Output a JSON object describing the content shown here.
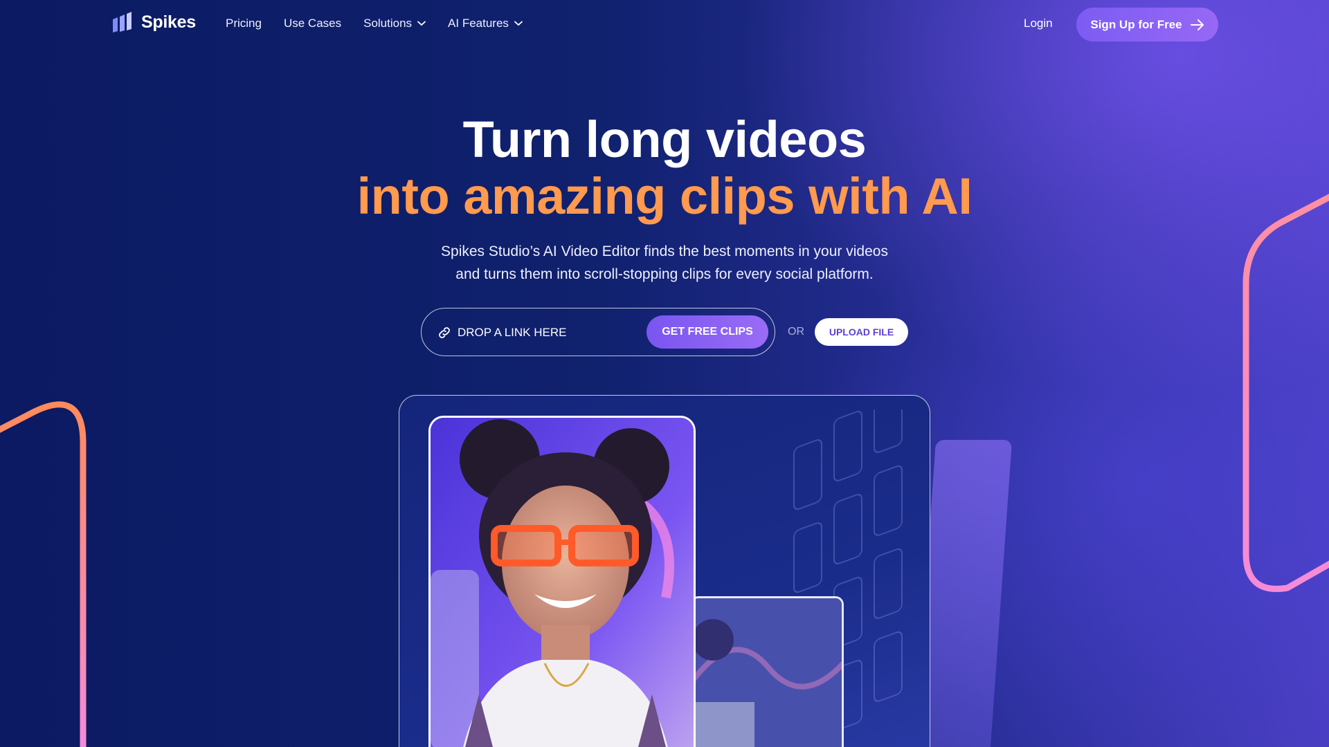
{
  "brand": {
    "name": "Spikes"
  },
  "nav": {
    "links": [
      {
        "label": "Pricing",
        "has_dropdown": false
      },
      {
        "label": "Use Cases",
        "has_dropdown": false
      },
      {
        "label": "Solutions",
        "has_dropdown": true
      },
      {
        "label": "AI Features",
        "has_dropdown": true
      }
    ],
    "login": "Login",
    "signup": "Sign Up for Free"
  },
  "hero": {
    "title_line1": "Turn long videos",
    "title_line2": "into amazing clips with AI",
    "subtitle_line1": "Spikes Studio’s AI Video Editor finds the best moments in your videos",
    "subtitle_line2": "and turns them into scroll-stopping clips for every social platform.",
    "link_placeholder": "DROP A LINK HERE",
    "cta_label": "GET FREE CLIPS",
    "or_label": "OR",
    "upload_label": "UPLOAD FILE"
  },
  "colors": {
    "background": "#0c1a66",
    "accent_purple": "#7c5cf3",
    "title_orange": "#ff9a4e",
    "deco_gradient_start": "#ff8a5b",
    "deco_gradient_end": "#f58bd8"
  },
  "icons": {
    "logo": "bars-logo-icon",
    "arrow": "arrow-right-icon",
    "link": "link-icon",
    "chevron": "chevron-down-icon"
  }
}
